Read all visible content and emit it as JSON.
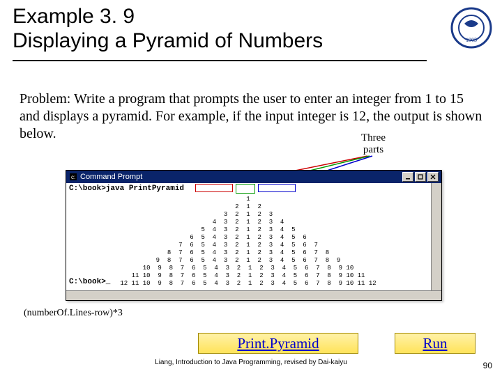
{
  "title": {
    "line1": "Example 3. 9",
    "line2": "Displaying a Pyramid of Numbers"
  },
  "problem_text": "Problem: Write a program that prompts the user to enter an integer from 1 to 15 and displays a pyramid. For example, if the input integer is 12, the output is shown below.",
  "three_parts": {
    "line1": "Three",
    "line2": "parts"
  },
  "console": {
    "title": "Command Prompt",
    "cmdline": "C:\\book>java  PrintPyramid",
    "prompt2": "C:\\book>_",
    "pyramid_rows": [
      "1",
      "2  1  2",
      "3  2  1  2  3",
      "4  3  2  1  2  3  4",
      "5  4  3  2  1  2  3  4  5",
      "6  5  4  3  2  1  2  3  4  5  6",
      "7  6  5  4  3  2  1  2  3  4  5  6  7",
      "8  7  6  5  4  3  2  1  2  3  4  5  6  7  8",
      "9  8  7  6  5  4  3  2  1  2  3  4  5  6  7  8  9",
      "10  9  8  7  6  5  4  3  2  1  2  3  4  5  6  7  8  9 10",
      "11 10  9  8  7  6  5  4  3  2  1  2  3  4  5  6  7  8  9 10 11",
      "12 11 10  9  8  7  6  5  4  3  2  1  2  3  4  5  6  7  8  9 10 11 12"
    ]
  },
  "formula": "(numberOf.Lines-row)*3",
  "buttons": {
    "print": "Print.Pyramid",
    "run": "Run"
  },
  "footer": "Liang, Introduction to Java Programming, revised by Dai-kaiyu",
  "page_number": "90"
}
